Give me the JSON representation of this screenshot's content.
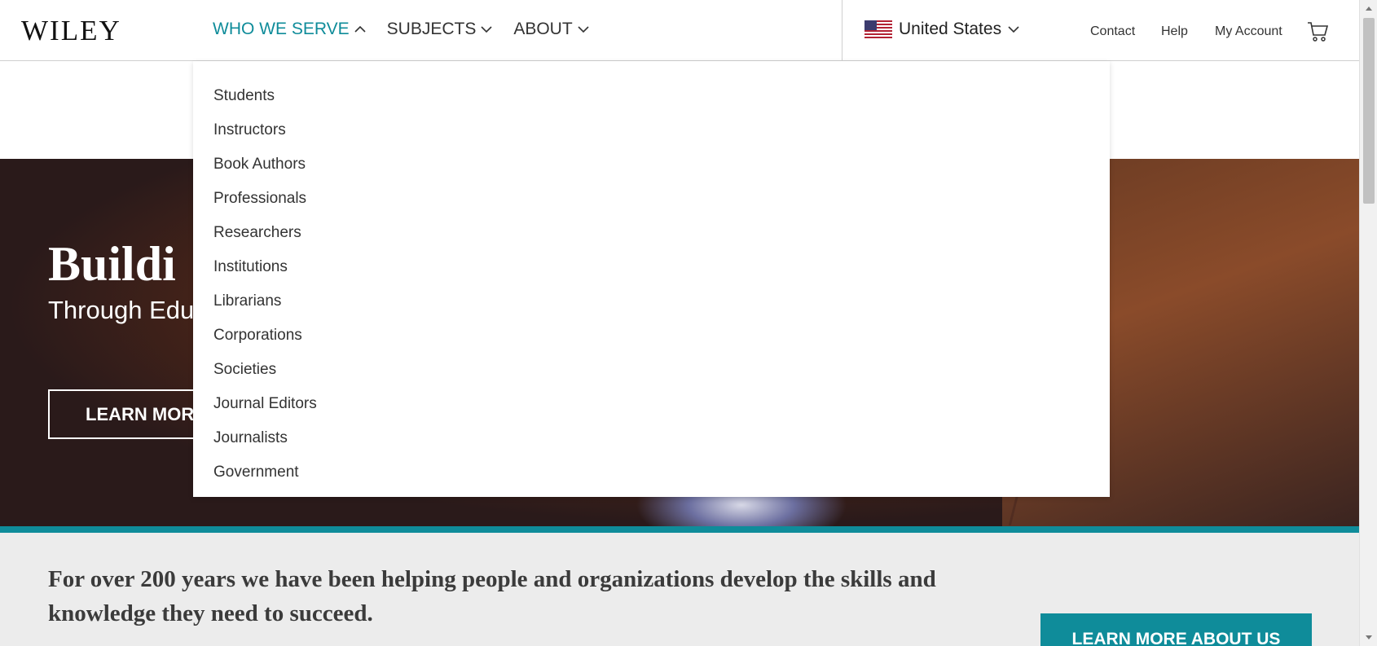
{
  "header": {
    "logo": "WILEY",
    "nav": [
      {
        "label": "WHO WE SERVE",
        "active": true
      },
      {
        "label": "SUBJECTS",
        "active": false
      },
      {
        "label": "ABOUT",
        "active": false
      }
    ],
    "country": "United States",
    "links": [
      "Contact",
      "Help",
      "My Account"
    ]
  },
  "dropdown": {
    "items": [
      "Students",
      "Instructors",
      "Book Authors",
      "Professionals",
      "Researchers",
      "Institutions",
      "Librarians",
      "Corporations",
      "Societies",
      "Journal Editors",
      "Journalists",
      "Government"
    ]
  },
  "hero": {
    "title": "Buildi",
    "subtitle": "Through Edu",
    "button": "LEARN MOR"
  },
  "band": {
    "text": "For over 200 years we have been helping people and organizations develop the skills and knowledge they need to succeed.",
    "button": "LEARN MORE ABOUT US"
  },
  "colors": {
    "accent": "#0f8c9a"
  }
}
